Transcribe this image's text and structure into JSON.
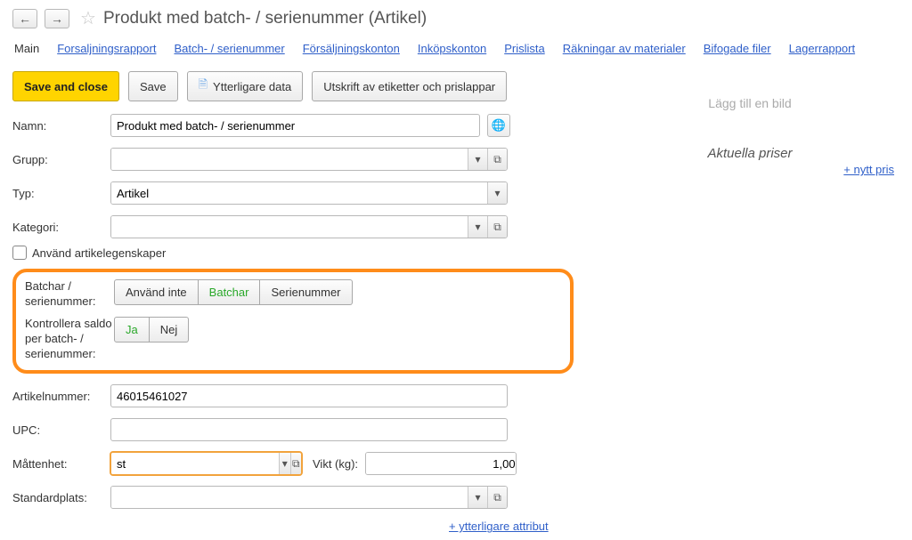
{
  "title": "Produkt med batch- / serienummer (Artikel)",
  "tabs": [
    "Main",
    "Forsaljningsrapport",
    "Batch- / serienummer",
    "Försäljningskonton",
    "Inköpskonton",
    "Prislista",
    "Räkningar av materialer",
    "Bifogade filer",
    "Lagerrapport"
  ],
  "toolbar": {
    "save_close": "Save and close",
    "save": "Save",
    "extra": "Ytterligare data",
    "print": "Utskrift av etiketter och prislappar"
  },
  "labels": {
    "name": "Namn:",
    "group": "Grupp:",
    "type": "Typ:",
    "category": "Kategori:",
    "use_props": "Använd artikelegenskaper",
    "batch_serial": "Batchar / serienummer:",
    "balance": "Kontrollera saldo per batch- / serienummer:",
    "article_no": "Artikelnummer:",
    "upc": "UPC:",
    "uom": "Måttenhet:",
    "weight": "Vikt (kg):",
    "default_location": "Standardplats:",
    "more_attrs": "+ ytterligare attribut",
    "add_image": "Lägg till en bild",
    "prices_title": "Aktuella priser",
    "new_price": "+ nytt pris"
  },
  "values": {
    "name": "Produkt med batch- / serienummer",
    "group": "",
    "type": "Artikel",
    "category": "",
    "article_no": "46015461027",
    "upc": "",
    "uom": "st",
    "weight": "1,0000",
    "default_location": ""
  },
  "batch_options": [
    "Använd inte",
    "Batchar",
    "Serienummer"
  ],
  "balance_options": [
    "Ja",
    "Nej"
  ]
}
